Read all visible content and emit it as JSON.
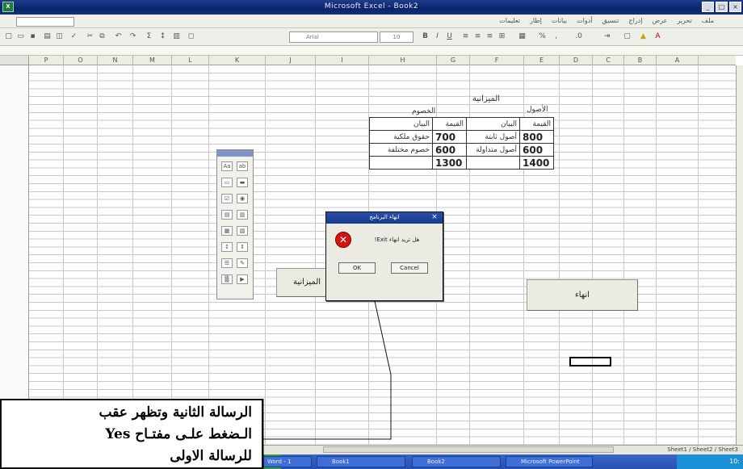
{
  "window": {
    "title": "Microsoft Excel - Book2",
    "app_icon": "excel-icon"
  },
  "menubar": {
    "name_box": "",
    "menus": [
      "تعليمات",
      "إطار",
      "بيانات",
      "أدوات",
      "تنسيق",
      "إدراج",
      "عرض",
      "تحرير",
      "ملف"
    ]
  },
  "toolbar": {
    "font": "Arial",
    "font_size": "10"
  },
  "columns": [
    "P",
    "O",
    "N",
    "M",
    "L",
    "K",
    "J",
    "I",
    "H",
    "G",
    "F",
    "E",
    "D",
    "C",
    "B",
    "A"
  ],
  "sheet": {
    "budget_title": "الميزانية",
    "liabilities_header": "الخصوم",
    "assets_header": "الأصول",
    "table": {
      "header": [
        "البيان",
        "القيمة",
        "البيان",
        "القيمة"
      ],
      "rows": [
        [
          "حقوق ملكية",
          "700",
          "أصول ثابتة",
          "800"
        ],
        [
          "خصوم مختلفة",
          "600",
          "أصول متداولة",
          "600"
        ],
        [
          "",
          "1300",
          "",
          "1400"
        ]
      ]
    },
    "budget_button": "الميزانية",
    "end_button": "انهاء"
  },
  "dialog": {
    "title": "انهاء البرنامج",
    "message": "هل تريد انهاء Exit!",
    "ok": "OK",
    "cancel": "Cancel",
    "icon": "error-icon"
  },
  "callout": {
    "lines": [
      "الرسالة الثانية وتظهر عقب",
      "الـضغط علـى مفتـاح Yes",
      "للرسالة الاولى"
    ]
  },
  "sheet_tabs": "Sheet1 / Sheet2 / Sheet3",
  "taskbar": {
    "items": [
      "Word - 1",
      "Book1",
      "Book2",
      "Microsoft PowerPoint"
    ],
    "clock": "10:"
  }
}
